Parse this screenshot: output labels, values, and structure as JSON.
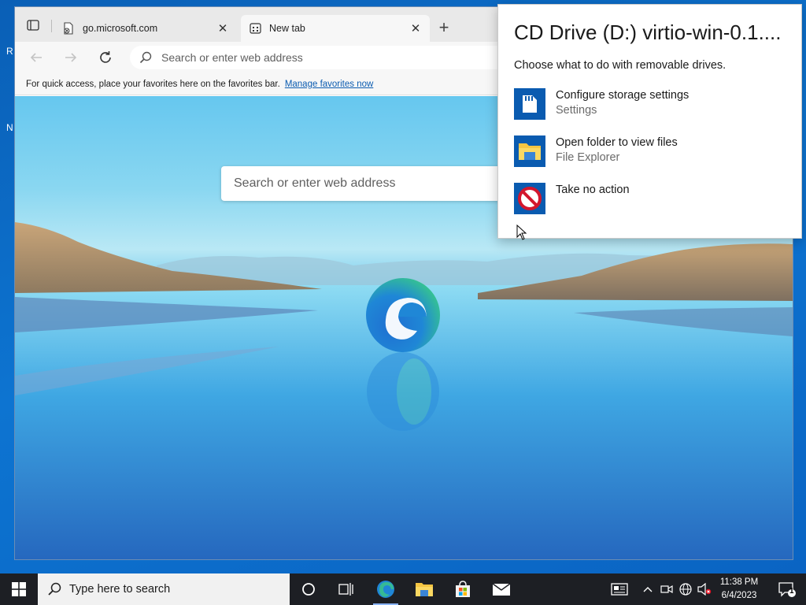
{
  "desktop": {
    "icon_fragments": [
      "R",
      "N"
    ]
  },
  "browser": {
    "tabs": [
      {
        "label": "go.microsoft.com",
        "active": false
      },
      {
        "label": "New tab",
        "active": true
      }
    ],
    "address_placeholder": "Search or enter web address",
    "favorites_bar": {
      "text": "For quick access, place your favorites here on the favorites bar.",
      "link": "Manage favorites now"
    },
    "new_tab_page": {
      "search_placeholder": "Search or enter web address"
    }
  },
  "autoplay": {
    "title": "CD Drive (D:) virtio-win-0.1....",
    "subtitle": "Choose what to do with removable drives.",
    "options": [
      {
        "label": "Configure storage settings",
        "sub": "Settings",
        "icon": "sd-card-icon"
      },
      {
        "label": "Open folder to view files",
        "sub": "File Explorer",
        "icon": "folder-icon"
      },
      {
        "label": "Take no action",
        "sub": "",
        "icon": "no-action-icon"
      }
    ]
  },
  "taskbar": {
    "search_placeholder": "Type here to search",
    "time": "11:38 PM",
    "date": "6/4/2023",
    "notification_count": "1",
    "pinned": [
      "cortana-icon",
      "task-view-icon",
      "edge-icon",
      "file-explorer-icon",
      "store-icon",
      "mail-icon"
    ]
  },
  "colors": {
    "accent": "#0a5bb0",
    "taskbar": "#1d1f24",
    "desktop": "#0d74d1"
  }
}
